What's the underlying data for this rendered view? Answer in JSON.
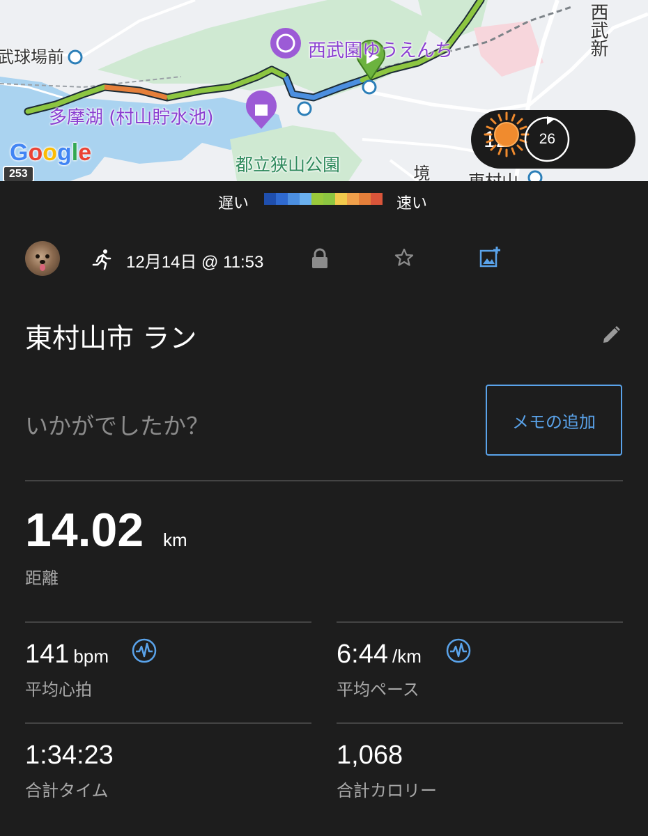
{
  "map": {
    "labels": {
      "station_left": "武球場前",
      "amusement_park": "西武園ゆうえんち",
      "lake": "多摩湖 (村山貯水池)",
      "park": "都立狭山公園",
      "station_bottom": "東村山",
      "line_right": "西武新",
      "side_char": "境"
    },
    "google_logo": "Google",
    "route_badge": "253",
    "weather": {
      "temperature": "12°",
      "icon": "sun-icon",
      "indicator": "26"
    }
  },
  "legend": {
    "slow_label": "遅い",
    "fast_label": "速い",
    "colors": [
      "#1f4fae",
      "#2f6ad0",
      "#4c8fe0",
      "#6ab0ee",
      "#9ac93b",
      "#8dc641",
      "#f2c94c",
      "#f0a04b",
      "#e57f3a",
      "#d9553a"
    ]
  },
  "activity": {
    "type_icon": "running-icon",
    "datetime": "12月14日 @ 11:53",
    "title": "東村山市 ラン",
    "question_placeholder": "いかがでしたか？",
    "memo_button": "メモの追加"
  },
  "stats": {
    "distance": {
      "value": "14.02",
      "unit": "km",
      "label": "距離"
    },
    "heart_rate": {
      "value": "141",
      "unit": "bpm",
      "label": "平均心拍"
    },
    "pace": {
      "value": "6:44",
      "unit": "/km",
      "label": "平均ペース"
    },
    "total_time": {
      "value": "1:34:23",
      "label": "合計タイム"
    },
    "calories": {
      "value": "1,068",
      "label": "合計カロリー"
    }
  },
  "colors": {
    "background": "#1d1d1d",
    "accent": "#5aa3ea",
    "secondary_text": "#a8a8a8"
  }
}
